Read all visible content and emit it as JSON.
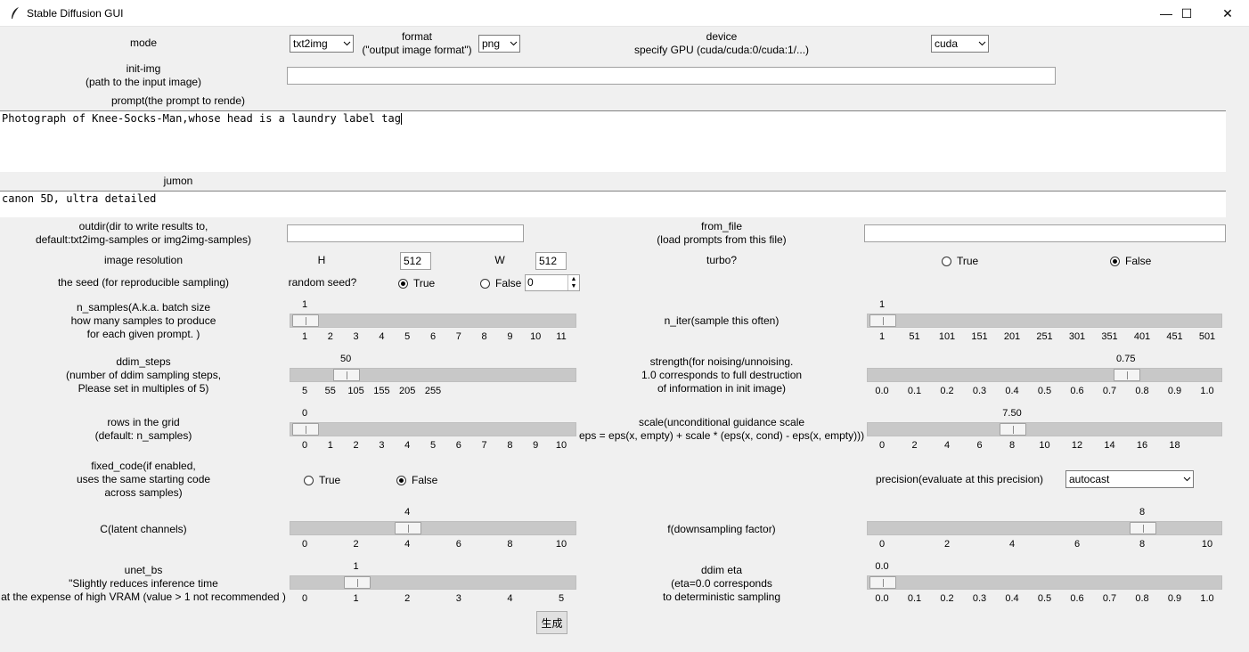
{
  "window": {
    "title": "Stable Diffusion GUI",
    "minimize": "—",
    "maximize": "☐",
    "close": "✕"
  },
  "mode": {
    "label": "mode",
    "value": "txt2img"
  },
  "format": {
    "label1": "format",
    "label2": "(\"output image format\")",
    "value": "png"
  },
  "device": {
    "label1": "device",
    "label2": "specify GPU (cuda/cuda:0/cuda:1/...)",
    "value": "cuda"
  },
  "init_img": {
    "label1": "init-img",
    "label2": "(path to the input image)",
    "value": ""
  },
  "prompt": {
    "label": "prompt(the prompt to rende)",
    "value": "Photograph of Knee-Socks-Man,whose head is a laundry label tag"
  },
  "jumon": {
    "label": "jumon",
    "value": "canon 5D, ultra detailed"
  },
  "outdir": {
    "label1": "outdir(dir to write results to,",
    "label2": "default:txt2img-samples or img2img-samples)",
    "value": ""
  },
  "from_file": {
    "label1": "from_file",
    "label2": "(load prompts from this file)",
    "value": ""
  },
  "resolution": {
    "label": "image resolution",
    "h_label": "H",
    "h_value": "512",
    "w_label": "W",
    "w_value": "512"
  },
  "turbo": {
    "label": "turbo?",
    "opt_true": "True",
    "opt_false": "False",
    "selected": "False"
  },
  "seed": {
    "label": "the seed (for reproducible sampling)",
    "random_label": "random seed?",
    "opt_true": "True",
    "opt_false": "False",
    "selected": "True",
    "value": "0"
  },
  "n_samples": {
    "label1": "n_samples(A.k.a. batch size",
    "label2": "how many samples to produce",
    "label3": "for each given prompt. )",
    "value": "1",
    "fraction": 0.0,
    "ticks": [
      "1",
      "2",
      "3",
      "4",
      "5",
      "6",
      "7",
      "8",
      "9",
      "10",
      "11"
    ]
  },
  "n_iter": {
    "label": "n_iter(sample this often)",
    "value": "1",
    "fraction": 0.0,
    "ticks": [
      "1",
      "51",
      "101",
      "151",
      "201",
      "251",
      "301",
      "351",
      "401",
      "451",
      "501"
    ]
  },
  "ddim_steps": {
    "label1": "ddim_steps",
    "label2": "(number of ddim sampling steps,",
    "label3": "Please set in multiples of 5)",
    "value": "50",
    "fraction": 0.16,
    "ticks": [
      "5",
      "55",
      "105",
      "155",
      "205",
      "255"
    ]
  },
  "strength": {
    "label1": "strength(for noising/unnoising.",
    "label2": "1.0 corresponds to full destruction",
    "label3": "of information in init image)",
    "value": "0.75",
    "fraction": 0.75,
    "ticks": [
      "0.0",
      "0.1",
      "0.2",
      "0.3",
      "0.4",
      "0.5",
      "0.6",
      "0.7",
      "0.8",
      "0.9",
      "1.0"
    ]
  },
  "rows": {
    "label1": "rows in the grid",
    "label2": "(default: n_samples)",
    "value": "0",
    "fraction": 0.0,
    "ticks": [
      "0",
      "1",
      "2",
      "3",
      "4",
      "5",
      "6",
      "7",
      "8",
      "9",
      "10"
    ]
  },
  "scale": {
    "label1": "scale(unconditional guidance scale",
    "label2": "eps = eps(x, empty) + scale * (eps(x, cond) - eps(x, empty)))",
    "value": "7.50",
    "fraction": 0.4,
    "ticks": [
      "0",
      "2",
      "4",
      "6",
      "8",
      "10",
      "12",
      "14",
      "16",
      "18"
    ]
  },
  "fixed_code": {
    "label1": "fixed_code(if enabled,",
    "label2": "uses the same starting code",
    "label3": "across samples)",
    "opt_true": "True",
    "opt_false": "False",
    "selected": "False"
  },
  "precision": {
    "label": "precision(evaluate at this precision)",
    "value": "autocast"
  },
  "c_channels": {
    "label": "C(latent channels)",
    "value": "4",
    "fraction": 0.4,
    "ticks": [
      "0",
      "2",
      "4",
      "6",
      "8",
      "10"
    ]
  },
  "f_factor": {
    "label": "f(downsampling factor)",
    "value": "8",
    "fraction": 0.8,
    "ticks": [
      "0",
      "2",
      "4",
      "6",
      "8",
      "10"
    ]
  },
  "unet_bs": {
    "label1": "unet_bs",
    "label2": "\"Slightly reduces inference time",
    "label3": "at the expense of high VRAM (value > 1 not recommended )",
    "value": "1",
    "fraction": 0.2,
    "ticks": [
      "0",
      "1",
      "2",
      "3",
      "4",
      "5"
    ]
  },
  "ddim_eta": {
    "label1": "ddim eta",
    "label2": "(eta=0.0 corresponds",
    "label3": "to deterministic sampling",
    "value": "0.0",
    "fraction": 0.0,
    "ticks": [
      "0.0",
      "0.1",
      "0.2",
      "0.3",
      "0.4",
      "0.5",
      "0.6",
      "0.7",
      "0.8",
      "0.9",
      "1.0"
    ]
  },
  "generate": {
    "label": "生成"
  }
}
